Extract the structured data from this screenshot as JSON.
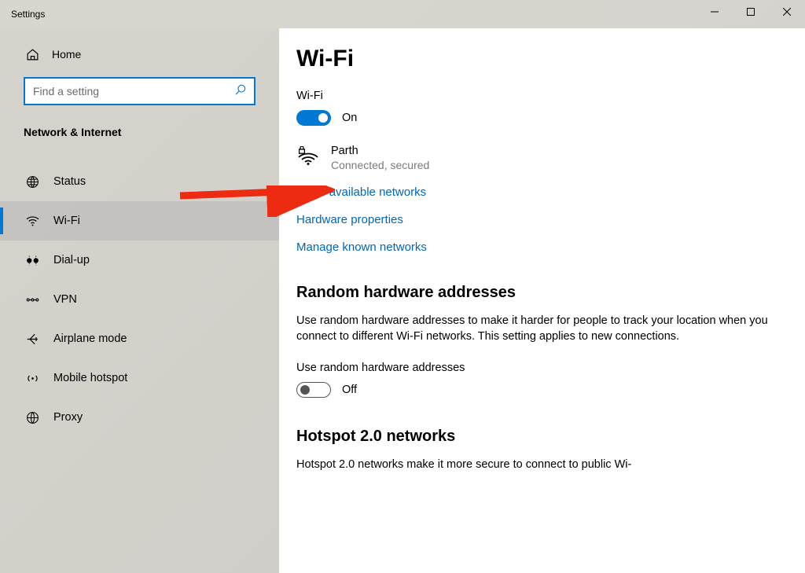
{
  "window": {
    "title": "Settings"
  },
  "sidebar": {
    "home_label": "Home",
    "search_placeholder": "Find a setting",
    "category": "Network & Internet",
    "items": [
      {
        "label": "Status"
      },
      {
        "label": "Wi-Fi"
      },
      {
        "label": "Dial-up"
      },
      {
        "label": "VPN"
      },
      {
        "label": "Airplane mode"
      },
      {
        "label": "Mobile hotspot"
      },
      {
        "label": "Proxy"
      }
    ]
  },
  "main": {
    "page_title": "Wi-Fi",
    "wifi_toggle": {
      "label": "Wi-Fi",
      "state_label": "On",
      "on": true
    },
    "network": {
      "name": "Parth",
      "status": "Connected, secured"
    },
    "links": [
      "Show available networks",
      "Hardware properties",
      "Manage known networks"
    ],
    "random_hw": {
      "title": "Random hardware addresses",
      "desc": "Use random hardware addresses to make it harder for people to track your location when you connect to different Wi-Fi networks. This setting applies to new connections.",
      "toggle_label": "Use random hardware addresses",
      "state_label": "Off"
    },
    "hotspot20": {
      "title": "Hotspot 2.0 networks",
      "desc": "Hotspot 2.0 networks make it more secure to connect to public Wi-"
    }
  },
  "colors": {
    "accent": "#0078d4",
    "link": "#0066bb"
  }
}
